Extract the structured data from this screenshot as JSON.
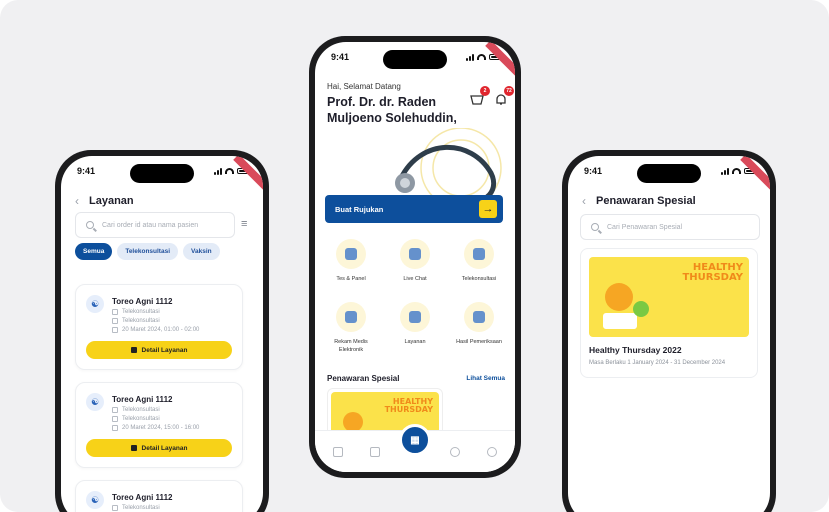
{
  "status_time": "9:41",
  "left": {
    "title": "Layanan",
    "search_placeholder": "Cari order id atau nama pasien",
    "chips": [
      "Semua",
      "Telekonsultasi",
      "Vaksin"
    ],
    "cards": [
      {
        "name": "Toreo Agni 1112",
        "type1": "Telekonsultasi",
        "type2": "Telekonsultasi",
        "datetime": "20 Maret 2024, 01:00 - 02:00",
        "button": "Detail Layanan"
      },
      {
        "name": "Toreo Agni 1112",
        "type1": "Telekonsultasi",
        "type2": "Telekonsultasi",
        "datetime": "20 Maret 2024, 15:00 - 16:00",
        "button": "Detail Layanan"
      },
      {
        "name": "Toreo Agni 1112",
        "type1": "Telekonsultasi"
      }
    ]
  },
  "middle": {
    "greeting": "Hai, Selamat Datang",
    "doctor_name": "Prof. Dr. dr. Raden Muljoeno Solehuddin,",
    "cart_badge": "2",
    "notif_badge": "72",
    "referral_button": "Buat Rujukan",
    "menu": [
      {
        "label": "Tes & Panel"
      },
      {
        "label": "Live Chat"
      },
      {
        "label": "Telekonsultasi"
      },
      {
        "label": "Rekam Medis Elektronik"
      },
      {
        "label": "Layanan"
      },
      {
        "label": "Hasil Pemeriksaan"
      }
    ],
    "section_title": "Penawaran Spesial",
    "see_all": "Lihat Semua",
    "promo_image_text": "HEALTHY THURSDAY"
  },
  "right": {
    "title": "Penawaran Spesial",
    "search_placeholder": "Cari Penawaran Spesial",
    "promo": {
      "image_text": "HEALTHY THURSDAY",
      "name": "Healthy Thursday 2022",
      "validity": "Masa Berlaku 1 January 2024 - 31 December 2024"
    }
  },
  "colors": {
    "primary": "#0d4f9c",
    "accent": "#f7d218",
    "badge": "#e0262e"
  }
}
